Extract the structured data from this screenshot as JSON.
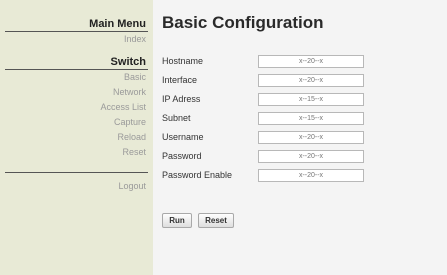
{
  "sidebar": {
    "main_menu_heading": "Main Menu",
    "main_items": [
      {
        "label": "Index"
      }
    ],
    "switch_heading": "Switch",
    "switch_items": [
      {
        "label": "Basic"
      },
      {
        "label": "Network"
      },
      {
        "label": "Access List"
      },
      {
        "label": "Capture"
      },
      {
        "label": "Reload"
      },
      {
        "label": "Reset"
      }
    ],
    "logout_label": "Logout"
  },
  "main": {
    "title": "Basic Configuration",
    "fields": [
      {
        "label": "Hostname",
        "placeholder": "x--20--x"
      },
      {
        "label": "Interface",
        "placeholder": "x--20--x"
      },
      {
        "label": "IP Adress",
        "placeholder": "x--15--x"
      },
      {
        "label": "Subnet",
        "placeholder": "x--15--x"
      },
      {
        "label": "Username",
        "placeholder": "x--20--x"
      },
      {
        "label": "Password",
        "placeholder": "x--20--x"
      },
      {
        "label": "Password Enable",
        "placeholder": "x--20--x"
      }
    ],
    "run_label": "Run",
    "reset_label": "Reset"
  }
}
